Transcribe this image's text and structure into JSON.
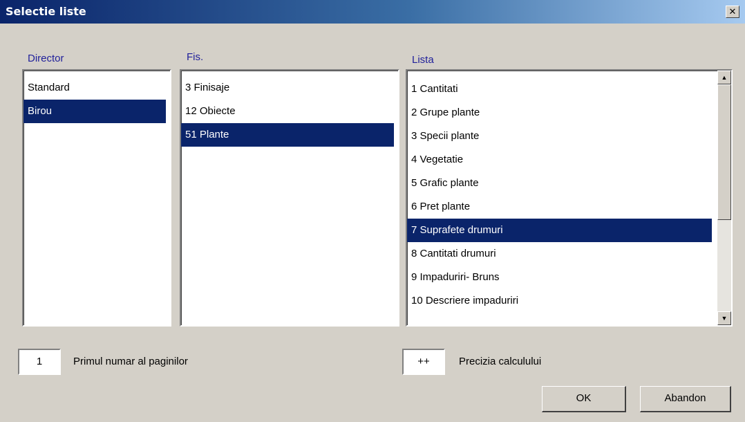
{
  "window": {
    "title": "Selectie liste",
    "close_glyph": "✕"
  },
  "director": {
    "label": "Director",
    "items": [
      {
        "text": "Standard",
        "selected": false
      },
      {
        "text": "Birou",
        "selected": true
      }
    ]
  },
  "fis": {
    "label": "Fis.",
    "items": [
      {
        "text": " 3 Finisaje",
        "selected": false
      },
      {
        "text": "12 Obiecte",
        "selected": false
      },
      {
        "text": "51 Plante",
        "selected": true
      }
    ]
  },
  "lista": {
    "label": "Lista",
    "items": [
      {
        "text": "1 Cantitati",
        "selected": false
      },
      {
        "text": "2 Grupe plante",
        "selected": false
      },
      {
        "text": "3 Specii plante",
        "selected": false
      },
      {
        "text": "4 Vegetatie",
        "selected": false
      },
      {
        "text": "5 Grafic plante",
        "selected": false
      },
      {
        "text": "6 Pret plante",
        "selected": false
      },
      {
        "text": "7 Suprafete drumuri",
        "selected": true
      },
      {
        "text": "8 Cantitati drumuri",
        "selected": false
      },
      {
        "text": "9 Impaduriri- Bruns",
        "selected": false
      },
      {
        "text": "10 Descriere impaduriri",
        "selected": false
      }
    ],
    "scroll_up_glyph": "▲",
    "scroll_down_glyph": "▼"
  },
  "page_start": {
    "value": "1",
    "label": "Primul numar al paginilor"
  },
  "precision": {
    "value": "++",
    "label": "Precizia calculului"
  },
  "buttons": {
    "ok": "OK",
    "cancel": "Abandon"
  },
  "colors": {
    "selection": "#0a246a",
    "group_label": "#1f1f9a",
    "dialog_bg": "#d4d0c8"
  }
}
